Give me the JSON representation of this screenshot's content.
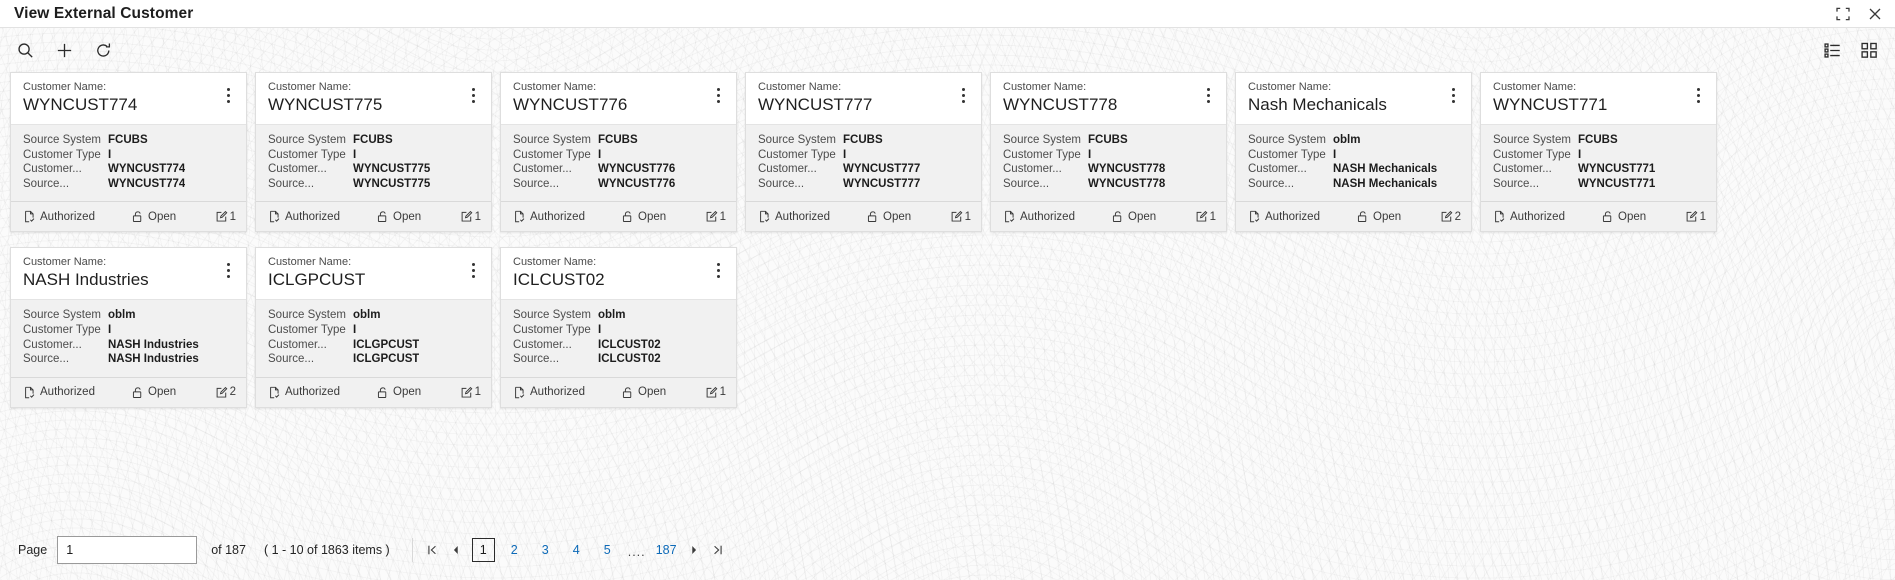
{
  "window": {
    "title": "View External Customer",
    "restore_icon": "restore-window-icon",
    "close_icon": "close-icon"
  },
  "toolbar": {
    "search_icon": "search-icon",
    "add_icon": "plus-icon",
    "refresh_icon": "refresh-icon",
    "list_view_icon": "list-view-icon",
    "grid_view_icon": "grid-view-icon"
  },
  "card_fields": {
    "name_label": "Customer Name:",
    "keys": [
      "Source System",
      "Customer Type",
      "Customer...",
      "Source..."
    ],
    "menu_icon": "kebab-menu-icon",
    "auth_icon": "document-check-icon",
    "open_icon": "unlock-icon",
    "edit_icon": "edit-square-icon"
  },
  "cards": [
    {
      "name": "WYNCUST774",
      "source_system": "FCUBS",
      "customer_type": "I",
      "customer_no": "WYNCUST774",
      "source_ref": "WYNCUST774",
      "auth_status": "Authorized",
      "record_status": "Open",
      "mod_count": "1"
    },
    {
      "name": "WYNCUST775",
      "source_system": "FCUBS",
      "customer_type": "I",
      "customer_no": "WYNCUST775",
      "source_ref": "WYNCUST775",
      "auth_status": "Authorized",
      "record_status": "Open",
      "mod_count": "1"
    },
    {
      "name": "WYNCUST776",
      "source_system": "FCUBS",
      "customer_type": "I",
      "customer_no": "WYNCUST776",
      "source_ref": "WYNCUST776",
      "auth_status": "Authorized",
      "record_status": "Open",
      "mod_count": "1"
    },
    {
      "name": "WYNCUST777",
      "source_system": "FCUBS",
      "customer_type": "I",
      "customer_no": "WYNCUST777",
      "source_ref": "WYNCUST777",
      "auth_status": "Authorized",
      "record_status": "Open",
      "mod_count": "1"
    },
    {
      "name": "WYNCUST778",
      "source_system": "FCUBS",
      "customer_type": "I",
      "customer_no": "WYNCUST778",
      "source_ref": "WYNCUST778",
      "auth_status": "Authorized",
      "record_status": "Open",
      "mod_count": "1"
    },
    {
      "name": "Nash Mechanicals",
      "source_system": "oblm",
      "customer_type": "I",
      "customer_no": "NASH Mechanicals",
      "source_ref": "NASH Mechanicals",
      "auth_status": "Authorized",
      "record_status": "Open",
      "mod_count": "2"
    },
    {
      "name": "WYNCUST771",
      "source_system": "FCUBS",
      "customer_type": "I",
      "customer_no": "WYNCUST771",
      "source_ref": "WYNCUST771",
      "auth_status": "Authorized",
      "record_status": "Open",
      "mod_count": "1"
    },
    {
      "name": "NASH Industries",
      "source_system": "oblm",
      "customer_type": "I",
      "customer_no": "NASH Industries",
      "source_ref": "NASH Industries",
      "auth_status": "Authorized",
      "record_status": "Open",
      "mod_count": "2"
    },
    {
      "name": "ICLGPCUST",
      "source_system": "oblm",
      "customer_type": "I",
      "customer_no": "ICLGPCUST",
      "source_ref": "ICLGPCUST",
      "auth_status": "Authorized",
      "record_status": "Open",
      "mod_count": "1"
    },
    {
      "name": "ICLCUST02",
      "source_system": "oblm",
      "customer_type": "I",
      "customer_no": "ICLCUST02",
      "source_ref": "ICLCUST02",
      "auth_status": "Authorized",
      "record_status": "Open",
      "mod_count": "1"
    }
  ],
  "pagination": {
    "page_label": "Page",
    "page_value": "1",
    "of_text": "of 187",
    "items_text": "( 1 - 10 of 1863 items )",
    "first_icon": "go-to-first-page-icon",
    "prev_icon": "previous-page-icon",
    "next_icon": "next-page-icon",
    "last_icon": "go-to-last-page-icon",
    "pages": [
      "1",
      "2",
      "3",
      "4",
      "5"
    ],
    "ellipsis": "....",
    "last_page": "187",
    "current_page": "1"
  }
}
